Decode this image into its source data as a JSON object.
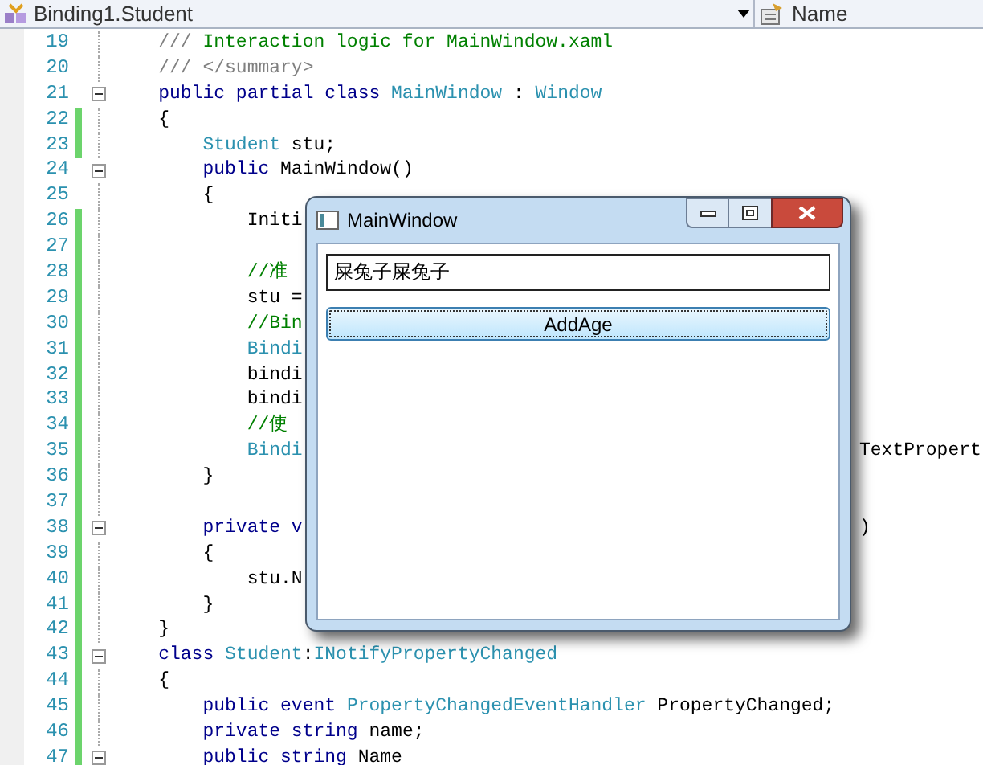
{
  "navbar": {
    "type_combo": "Binding1.Student",
    "member_combo": "Name"
  },
  "editor": {
    "lines": [
      {
        "number": "19",
        "changed": false,
        "fold": false,
        "segments": [
          {
            "kind": "doc",
            "text": "    ///"
          },
          {
            "kind": "comment",
            "text": " Interaction logic for MainWindow.xaml"
          }
        ]
      },
      {
        "number": "20",
        "changed": false,
        "fold": false,
        "segments": [
          {
            "kind": "doc",
            "text": "    /// </summary>"
          }
        ]
      },
      {
        "number": "21",
        "changed": false,
        "fold": true,
        "segments": [
          {
            "kind": "keyword",
            "text": "    public partial class "
          },
          {
            "kind": "type",
            "text": "MainWindow"
          },
          {
            "kind": "plain",
            "text": " : "
          },
          {
            "kind": "type",
            "text": "Window"
          }
        ]
      },
      {
        "number": "22",
        "changed": true,
        "fold": false,
        "segments": [
          {
            "kind": "plain",
            "text": "    {"
          }
        ]
      },
      {
        "number": "23",
        "changed": true,
        "fold": false,
        "segments": [
          {
            "kind": "type",
            "text": "        Student"
          },
          {
            "kind": "plain",
            "text": " stu;"
          }
        ]
      },
      {
        "number": "24",
        "changed": false,
        "fold": true,
        "segments": [
          {
            "kind": "keyword",
            "text": "        public "
          },
          {
            "kind": "plain",
            "text": "MainWindow()"
          }
        ]
      },
      {
        "number": "25",
        "changed": false,
        "fold": false,
        "segments": [
          {
            "kind": "plain",
            "text": "        {"
          }
        ]
      },
      {
        "number": "26",
        "changed": true,
        "fold": false,
        "segments": [
          {
            "kind": "plain",
            "text": "            Initi"
          }
        ]
      },
      {
        "number": "27",
        "changed": true,
        "fold": false
      },
      {
        "number": "28",
        "changed": true,
        "fold": false,
        "segments": [
          {
            "kind": "comment",
            "text": "            //准"
          }
        ]
      },
      {
        "number": "29",
        "changed": true,
        "fold": false,
        "segments": [
          {
            "kind": "plain",
            "text": "            stu ="
          }
        ]
      },
      {
        "number": "30",
        "changed": true,
        "fold": false,
        "segments": [
          {
            "kind": "comment",
            "text": "            //Bin"
          }
        ]
      },
      {
        "number": "31",
        "changed": true,
        "fold": false,
        "segments": [
          {
            "kind": "type",
            "text": "            Bindi"
          }
        ]
      },
      {
        "number": "32",
        "changed": true,
        "fold": false,
        "segments": [
          {
            "kind": "plain",
            "text": "            bindi"
          }
        ]
      },
      {
        "number": "33",
        "changed": true,
        "fold": false,
        "segments": [
          {
            "kind": "plain",
            "text": "            bindi"
          }
        ]
      },
      {
        "number": "34",
        "changed": true,
        "fold": false,
        "segments": [
          {
            "kind": "comment",
            "text": "            //使"
          }
        ]
      },
      {
        "number": "35",
        "changed": true,
        "fold": false,
        "segments": [
          {
            "kind": "type",
            "text": "            Bindi"
          }
        ],
        "tail": "TextPropert"
      },
      {
        "number": "36",
        "changed": true,
        "fold": false,
        "segments": [
          {
            "kind": "plain",
            "text": "        }"
          }
        ]
      },
      {
        "number": "37",
        "changed": true,
        "fold": false
      },
      {
        "number": "38",
        "changed": true,
        "fold": true,
        "segments": [
          {
            "kind": "keyword",
            "text": "        private v"
          }
        ],
        "tail": ")"
      },
      {
        "number": "39",
        "changed": true,
        "fold": false,
        "segments": [
          {
            "kind": "plain",
            "text": "        {"
          }
        ]
      },
      {
        "number": "40",
        "changed": true,
        "fold": false,
        "segments": [
          {
            "kind": "plain",
            "text": "            stu.N"
          }
        ]
      },
      {
        "number": "41",
        "changed": true,
        "fold": false,
        "segments": [
          {
            "kind": "plain",
            "text": "        }"
          }
        ]
      },
      {
        "number": "42",
        "changed": true,
        "fold": false,
        "segments": [
          {
            "kind": "plain",
            "text": "    }"
          }
        ]
      },
      {
        "number": "43",
        "changed": true,
        "fold": true,
        "segments": [
          {
            "kind": "keyword",
            "text": "    class "
          },
          {
            "kind": "type",
            "text": "Student"
          },
          {
            "kind": "plain",
            "text": ":"
          },
          {
            "kind": "type",
            "text": "INotifyPropertyChanged"
          }
        ]
      },
      {
        "number": "44",
        "changed": true,
        "fold": false,
        "segments": [
          {
            "kind": "plain",
            "text": "    {"
          }
        ]
      },
      {
        "number": "45",
        "changed": true,
        "fold": false,
        "segments": [
          {
            "kind": "keyword",
            "text": "        public event "
          },
          {
            "kind": "type",
            "text": "PropertyChangedEventHandler"
          },
          {
            "kind": "plain",
            "text": " PropertyChanged;"
          }
        ]
      },
      {
        "number": "46",
        "changed": true,
        "fold": false,
        "segments": [
          {
            "kind": "keyword",
            "text": "        private string "
          },
          {
            "kind": "plain",
            "text": "name;"
          }
        ]
      },
      {
        "number": "47",
        "changed": true,
        "fold": true,
        "segments": [
          {
            "kind": "keyword",
            "text": "        public string "
          },
          {
            "kind": "plain",
            "text": "Name"
          }
        ]
      }
    ]
  },
  "window": {
    "title": "MainWindow",
    "textbox_value": "屎兔子屎兔子",
    "button": "AddAge"
  }
}
